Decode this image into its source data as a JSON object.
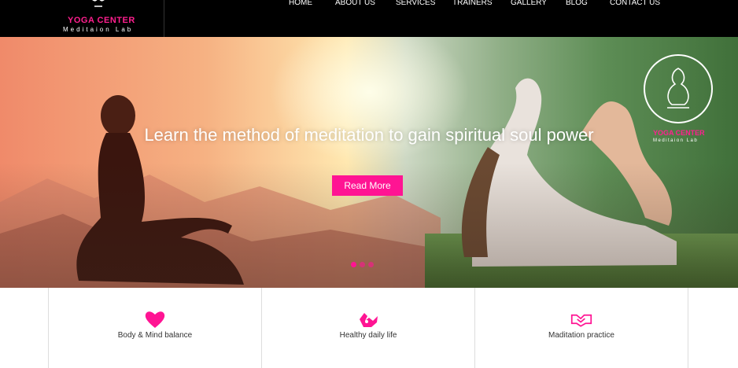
{
  "header": {
    "logo_brand": "YOGA CENTER",
    "logo_tagline": "Meditaion Lab"
  },
  "nav": {
    "items": [
      {
        "label": "HOME"
      },
      {
        "label": "ABOUT US"
      },
      {
        "label": "SERVICES"
      },
      {
        "label": "TRAINERS"
      },
      {
        "label": "GALLERY"
      },
      {
        "label": "BLOG"
      },
      {
        "label": "CONTACT US"
      }
    ]
  },
  "hero": {
    "headline": "Learn the method of meditation to gain spiritual soul power",
    "button_label": "Read More",
    "logo_brand": "YOGA CENTER",
    "logo_tagline": "Meditaion Lab",
    "slide_count": 3,
    "active_slide": 1
  },
  "features": [
    {
      "icon": "heart-icon",
      "label": "Body & Mind balance"
    },
    {
      "icon": "hands-icon",
      "label": "Healthy daily life"
    },
    {
      "icon": "handshake-icon",
      "label": "Maditation practice"
    }
  ],
  "colors": {
    "accent": "#ff1493",
    "nav_bg": "#000000"
  }
}
